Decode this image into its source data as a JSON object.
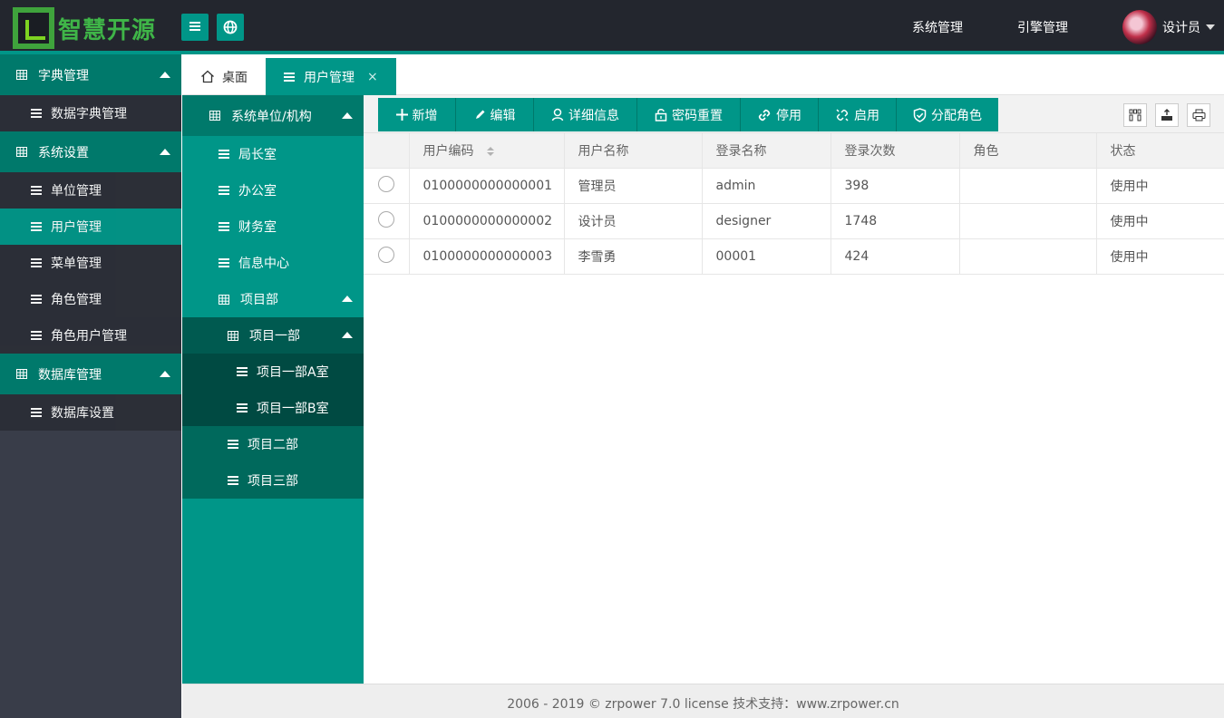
{
  "header": {
    "logo_text": "智慧开源",
    "nav": [
      "系统管理",
      "引擎管理"
    ],
    "user_name": "设计员"
  },
  "sidebar": {
    "groups": [
      {
        "label": "字典管理",
        "items": [
          {
            "label": "数据字典管理"
          }
        ]
      },
      {
        "label": "系统设置",
        "items": [
          {
            "label": "单位管理"
          },
          {
            "label": "用户管理"
          },
          {
            "label": "菜单管理"
          },
          {
            "label": "角色管理"
          },
          {
            "label": "角色用户管理"
          }
        ]
      },
      {
        "label": "数据库管理",
        "items": [
          {
            "label": "数据库设置"
          }
        ]
      }
    ],
    "active_item": "用户管理"
  },
  "tabs": [
    {
      "label": "桌面"
    },
    {
      "label": "用户管理",
      "close": "×"
    }
  ],
  "tree": {
    "root": "系统单位/机构",
    "nodes": [
      "局长室",
      "办公室",
      "财务室",
      "信息中心",
      "项目部"
    ],
    "project": {
      "label": "项目一部",
      "children": [
        "项目一部A室",
        "项目一部B室"
      ]
    },
    "siblings": [
      "项目二部",
      "项目三部"
    ]
  },
  "toolbar": {
    "buttons": [
      "新增",
      "编辑",
      "详细信息",
      "密码重置",
      "停用",
      "启用",
      "分配角色"
    ]
  },
  "table": {
    "columns": [
      "用户编码",
      "用户名称",
      "登录名称",
      "登录次数",
      "角色",
      "状态"
    ],
    "rows": [
      [
        "0100000000000001",
        "管理员",
        "admin",
        "398",
        "",
        "使用中"
      ],
      [
        "0100000000000002",
        "设计员",
        "designer",
        "1748",
        "",
        "使用中"
      ],
      [
        "0100000000000003",
        "李雪勇",
        "00001",
        "424",
        "",
        "使用中"
      ]
    ]
  },
  "footer": {
    "text": "2006 - 2019 © zrpower 7.0 license 技术支持：www.zrpower.cn"
  },
  "colors": {
    "accent": "#009688",
    "accent_dark": "#00796b",
    "header_bg": "#23262e",
    "sidebar_bg": "#393d49"
  }
}
